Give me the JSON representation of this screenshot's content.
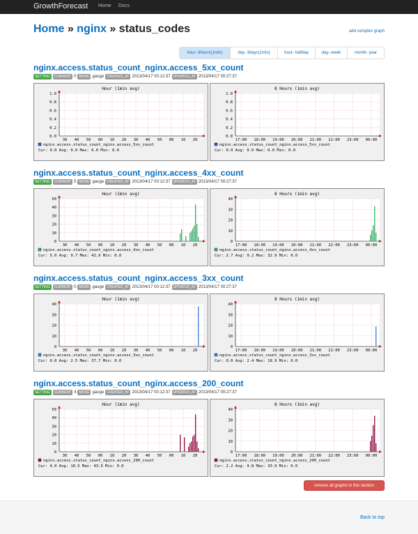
{
  "navbar": {
    "brand": "GrowthForecast",
    "links": [
      "Home",
      "Docs"
    ]
  },
  "header": {
    "home": "Home",
    "sep1": "»",
    "service": "nginx",
    "sep2": "»",
    "section": "status_codes",
    "add_complex": "add complex graph"
  },
  "tabs": [
    "hour- 8hours(1min)",
    "day- 3days(1min)",
    "hour- halfday",
    "day- week",
    "month- year"
  ],
  "active_tab": 0,
  "labels": {
    "setting": "SETTING",
    "current": "CURRENT",
    "mode": "MODE",
    "created": "CREATED_AT",
    "updated": "UPDATED_AT"
  },
  "remove_button": "remove all graphs in this section",
  "back_to_top": "Back to top",
  "colors": {
    "link": "#0a6ebd",
    "5xx": "#2f63b4",
    "4xx": "#3cb371",
    "3xx": "#4a86d8",
    "200": "#99184f"
  },
  "sections": [
    {
      "title": "nginx.access.status_count_nginx.access_5xx_count",
      "current": "0",
      "mode": "gauge",
      "created_at": "2013/04/17 00:12:37",
      "updated_at": "2013/04/17 00:27:37",
      "color": "#2f63b4",
      "chart_data": [
        {
          "type": "bar",
          "title": "Hour (1min avg)",
          "ylim": [
            0,
            1.0
          ],
          "yticks": [
            "1.0",
            "0.8",
            "0.6",
            "0.4",
            "0.2",
            "0.0"
          ],
          "xticks": [
            "30",
            "40",
            "50",
            "00",
            "10",
            "20",
            "30",
            "40",
            "50",
            "00",
            "10",
            "20"
          ],
          "series": [
            {
              "name": "nginx.access.status_count_nginx.access_5xx_count",
              "values": []
            }
          ],
          "stats": {
            "cur": "0.0",
            "avg": "0.0",
            "max": "0.0",
            "min": "0.0"
          }
        },
        {
          "type": "bar",
          "title": "8 Hours (1min avg)",
          "ylim": [
            0,
            1.0
          ],
          "yticks": [
            "1.0",
            "0.8",
            "0.6",
            "0.4",
            "0.2",
            "0.0"
          ],
          "xticks": [
            "17:00",
            "18:00",
            "19:00",
            "20:00",
            "21:00",
            "22:00",
            "23:00",
            "00:00"
          ],
          "series": [
            {
              "name": "nginx.access.status_count_nginx.access_5xx_count",
              "values": []
            }
          ],
          "stats": {
            "cur": "0.0",
            "avg": "0.0",
            "max": "0.0",
            "min": "0.0"
          }
        }
      ]
    },
    {
      "title": "nginx.access.status_count_nginx.access_4xx_count",
      "current": "5",
      "mode": "gauge",
      "created_at": "2013/04/17 00:12:37",
      "updated_at": "2013/04/17 00:27:37",
      "color": "#3cb371",
      "chart_data": [
        {
          "type": "bar",
          "title": "Hour (1min avg)",
          "ylim": [
            0,
            50
          ],
          "yticks": [
            "50",
            "40",
            "30",
            "20",
            "10",
            "0"
          ],
          "xticks": [
            "30",
            "40",
            "50",
            "00",
            "10",
            "20",
            "30",
            "40",
            "50",
            "00",
            "10",
            "20"
          ],
          "series": [
            {
              "name": "nginx.access.status_count_nginx.access_4xx_count",
              "values": [
                0,
                0,
                9,
                14,
                0,
                0,
                6,
                0,
                0,
                10,
                12,
                15,
                18,
                42.9,
                20,
                5
              ]
            }
          ],
          "stats": {
            "cur": "5.0",
            "avg": "9.7",
            "max": "42.9",
            "min": "0.0"
          }
        },
        {
          "type": "bar",
          "title": "8 Hours (1min avg)",
          "ylim": [
            0,
            40
          ],
          "yticks": [
            "40",
            "30",
            "20",
            "10",
            "0"
          ],
          "xticks": [
            "17:00",
            "18:00",
            "19:00",
            "20:00",
            "21:00",
            "22:00",
            "23:00",
            "00:00"
          ],
          "series": [
            {
              "name": "nginx.access.status_count_nginx.access_4xx_count",
              "values": [
                6,
                10,
                15,
                32.9,
                8
              ]
            }
          ],
          "stats": {
            "cur": "2.7",
            "avg": "9.2",
            "max": "32.9",
            "min": "0.0"
          }
        }
      ]
    },
    {
      "title": "nginx.access.status_count_nginx.access_3xx_count",
      "current": "0",
      "mode": "gauge",
      "created_at": "2013/04/17 00:12:37",
      "updated_at": "2013/04/17 00:27:37",
      "color": "#4a86d8",
      "chart_data": [
        {
          "type": "bar",
          "title": "Hour (1min avg)",
          "ylim": [
            0,
            40
          ],
          "yticks": [
            "40",
            "30",
            "20",
            "10",
            "0"
          ],
          "xticks": [
            "30",
            "40",
            "50",
            "00",
            "10",
            "20",
            "30",
            "40",
            "50",
            "00",
            "10",
            "20"
          ],
          "series": [
            {
              "name": "nginx.access.status_count_nginx.access_3xx_count",
              "values": [
                37.7
              ]
            }
          ],
          "stats": {
            "cur": "0.0",
            "avg": "2.5",
            "max": "37.7",
            "min": "0.0"
          }
        },
        {
          "type": "bar",
          "title": "8 Hours (1min avg)",
          "ylim": [
            0,
            40
          ],
          "yticks": [
            "40",
            "30",
            "20",
            "10",
            "0"
          ],
          "xticks": [
            "17:00",
            "18:00",
            "19:00",
            "20:00",
            "21:00",
            "22:00",
            "23:00",
            "00:00"
          ],
          "series": [
            {
              "name": "nginx.access.status_count_nginx.access_3xx_count",
              "values": [
                18.9
              ]
            }
          ],
          "stats": {
            "cur": "0.0",
            "avg": "2.4",
            "max": "18.9",
            "min": "0.0"
          }
        }
      ]
    },
    {
      "title": "nginx.access.status_count_nginx.access_200_count",
      "current": "4",
      "mode": "gauge",
      "created_at": "2013/04/17 00:12:37",
      "updated_at": "2013/04/17 00:27:37",
      "color": "#99184f",
      "chart_data": [
        {
          "type": "bar",
          "title": "Hour (1min avg)",
          "ylim": [
            0,
            50
          ],
          "yticks": [
            "50",
            "40",
            "30",
            "20",
            "10",
            "0"
          ],
          "xticks": [
            "30",
            "40",
            "50",
            "00",
            "10",
            "20",
            "30",
            "40",
            "50",
            "00",
            "10",
            "20"
          ],
          "series": [
            {
              "name": "nginx.access.status_count_nginx.access_200_count",
              "values": [
                0,
                0,
                20,
                0,
                0,
                17,
                0,
                0,
                6,
                10,
                12,
                18,
                20,
                43.9,
                12,
                4
              ]
            }
          ],
          "stats": {
            "cur": "4.0",
            "avg": "10.5",
            "max": "43.9",
            "min": "0.0"
          }
        },
        {
          "type": "bar",
          "title": "8 Hours (1min avg)",
          "ylim": [
            0,
            40
          ],
          "yticks": [
            "40",
            "30",
            "20",
            "10",
            "0"
          ],
          "xticks": [
            "17:00",
            "18:00",
            "19:00",
            "20:00",
            "21:00",
            "22:00",
            "23:00",
            "00:00"
          ],
          "series": [
            {
              "name": "nginx.access.status_count_nginx.access_200_count",
              "values": [
                10,
                15,
                25,
                33.9,
                8
              ]
            }
          ],
          "stats": {
            "cur": "2.2",
            "avg": "9.8",
            "max": "33.9",
            "min": "0.0"
          }
        }
      ]
    }
  ]
}
